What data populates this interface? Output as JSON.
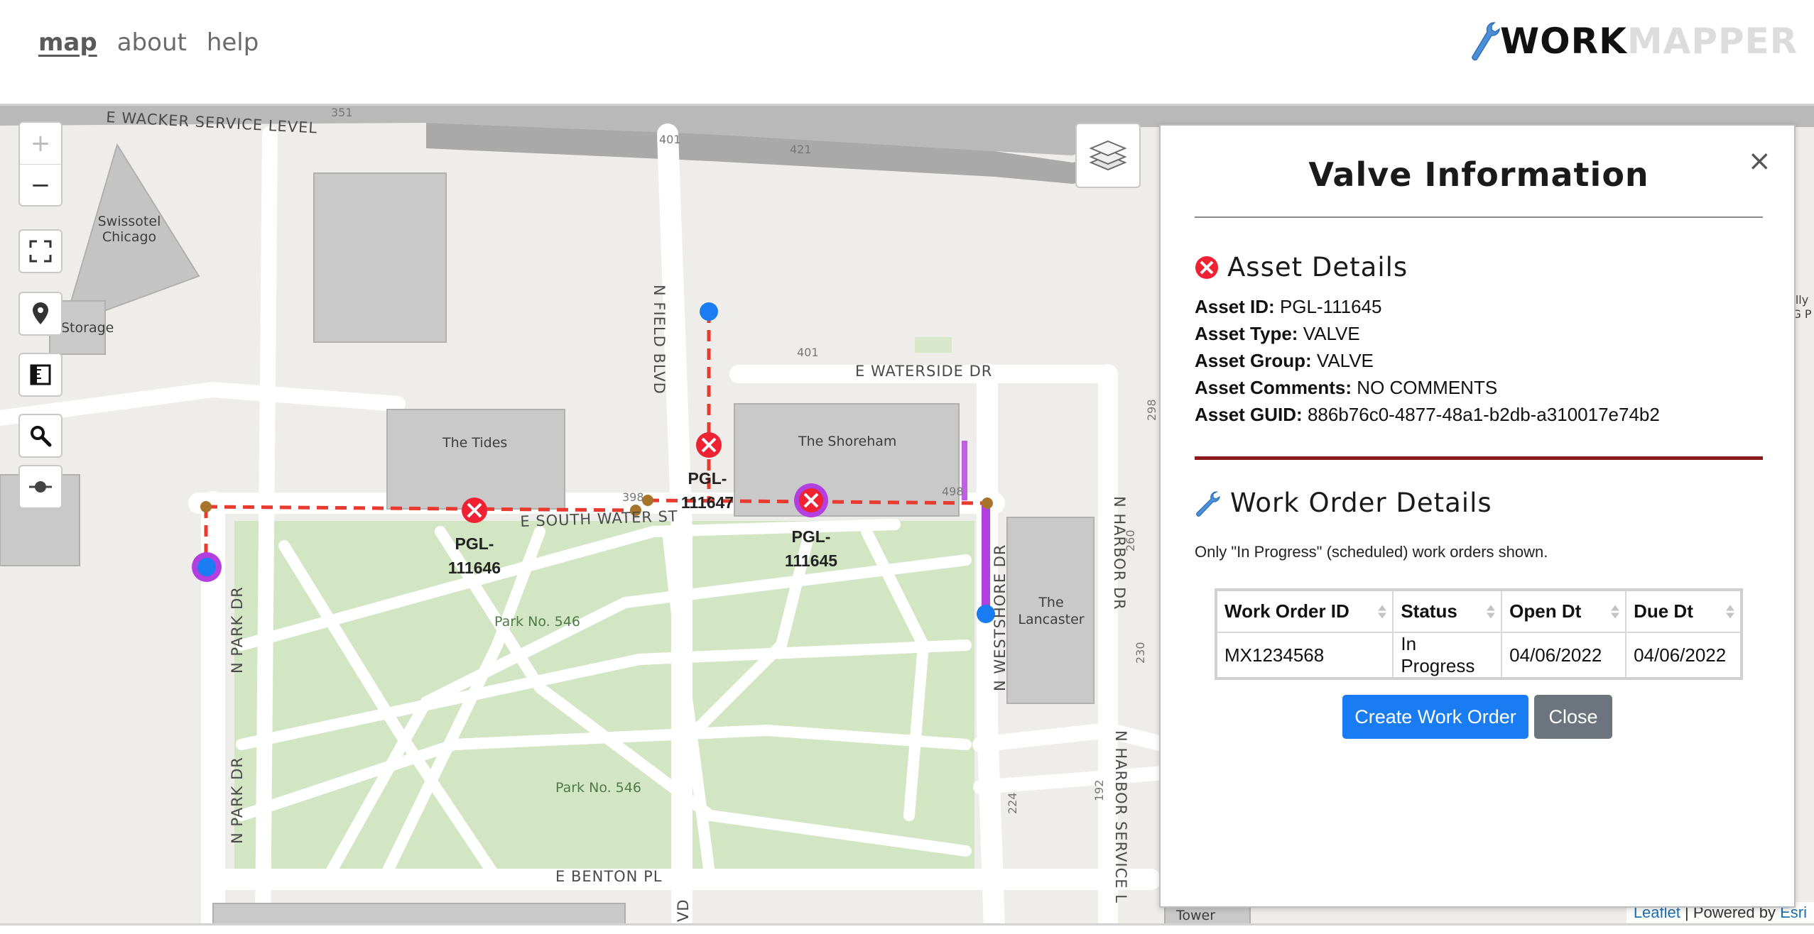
{
  "nav": {
    "items": [
      {
        "label": "map",
        "active": true
      },
      {
        "label": "about",
        "active": false
      },
      {
        "label": "help",
        "active": false
      }
    ]
  },
  "brand": {
    "part1": "WORK",
    "part2": "MAPPER",
    "icon": "wrench-icon"
  },
  "map": {
    "streets": {
      "wacker": "E WACKER SERVICE LEVEL",
      "waterside": "E WATERSIDE DR",
      "south_water": "E SOUTH WATER ST",
      "benton": "E BENTON PL",
      "field": "N FIELD BLVD",
      "park1": "N PARK DR",
      "park2": "N PARK DR",
      "westshore": "N WESTSHORE DR",
      "harbor": "N HARBOR DR",
      "harbor_service": "N HARBOR SERVICE L",
      "vd": "VD"
    },
    "buildings": {
      "swissotel": "Swissotel Chicago",
      "storage": "Storage",
      "tides": "The Tides",
      "shoreham": "The Shoreham",
      "lancaster": "The Lancaster",
      "tower": "Tower",
      "edge": "lly G P"
    },
    "parks": {
      "park_a": "Park No. 546",
      "park_b": "Park No. 546"
    },
    "numbers": {
      "n351": "351",
      "n401a": "401",
      "n421": "421",
      "n401b": "401",
      "n398": "398",
      "n498": "498",
      "n298": "298",
      "n260": "260",
      "n230": "230",
      "n224": "224",
      "n192": "192"
    },
    "assets": [
      {
        "id": "PGL-111646",
        "line1": "PGL-",
        "line2": "111646"
      },
      {
        "id": "PGL-111647",
        "line1": "PGL-",
        "line2": "111647"
      },
      {
        "id": "PGL-111645",
        "line1": "PGL-",
        "line2": "111645"
      }
    ],
    "controls": [
      "zoom-in",
      "zoom-out",
      "fullscreen",
      "locate",
      "measure",
      "search",
      "slider"
    ],
    "zoom_in_label": "+",
    "zoom_out_label": "−",
    "attribution": {
      "leaflet": "Leaflet",
      "separator": " | Powered by ",
      "esri": "Esri"
    }
  },
  "panel": {
    "title": "Valve Information",
    "close_label": "×",
    "asset_section": {
      "title": "Asset Details",
      "fields": [
        {
          "label": "Asset ID:",
          "value": "PGL-111645"
        },
        {
          "label": "Asset Type:",
          "value": "VALVE"
        },
        {
          "label": "Asset Group:",
          "value": "VALVE"
        },
        {
          "label": "Asset Comments:",
          "value": "NO COMMENTS"
        },
        {
          "label": "Asset GUID:",
          "value": "886b76c0-4877-48a1-b2db-a310017e74b2"
        }
      ]
    },
    "work_order_section": {
      "title": "Work Order Details",
      "note": "Only \"In Progress\" (scheduled) work orders shown.",
      "columns": [
        "Work Order ID",
        "Status",
        "Open Dt",
        "Due Dt"
      ],
      "rows": [
        [
          "MX1234568",
          "In Progress",
          "04/06/2022",
          "04/06/2022"
        ]
      ]
    },
    "buttons": {
      "create": "Create Work Order",
      "close": "Close"
    }
  },
  "colors": {
    "accent_blue": "#1a7cf2",
    "gray_button": "#6c757d",
    "divider_red": "#8b1a1a",
    "valve_red": "#ee2233",
    "pipe_red": "#e83a2e",
    "selection_purple": "#b43fe0",
    "node_blue": "#1a7cf2",
    "node_brown": "#a6752a",
    "park_green": "#d3e6c4"
  }
}
